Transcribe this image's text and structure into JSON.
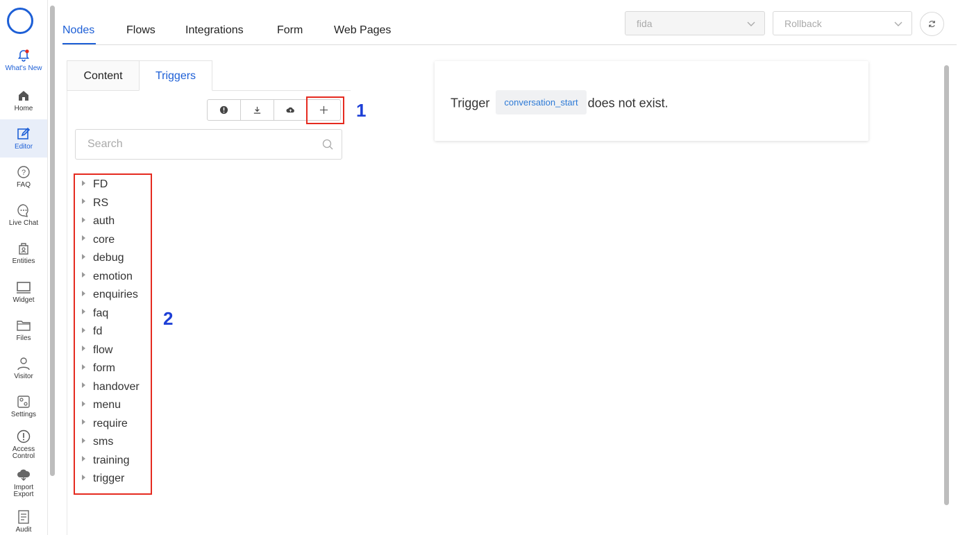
{
  "sidebar": {
    "items": [
      {
        "label": "What's New",
        "icon": "bell-icon"
      },
      {
        "label": "Home",
        "icon": "home-icon"
      },
      {
        "label": "Editor",
        "icon": "edit-icon"
      },
      {
        "label": "FAQ",
        "icon": "question-icon"
      },
      {
        "label": "Live Chat",
        "icon": "chat-icon"
      },
      {
        "label": "Entities",
        "icon": "entities-icon"
      },
      {
        "label": "Widget",
        "icon": "monitor-icon"
      },
      {
        "label": "Files",
        "icon": "folder-icon"
      },
      {
        "label": "Visitor",
        "icon": "user-icon"
      },
      {
        "label": "Settings",
        "icon": "settings-icon"
      },
      {
        "label": "Access Control",
        "icon": "alert-circle-icon"
      },
      {
        "label": "Import Export",
        "icon": "cloud-icon"
      },
      {
        "label": "Audit",
        "icon": "document-icon"
      }
    ],
    "active": "Editor"
  },
  "nav": {
    "tabs": [
      "Nodes",
      "Flows",
      "Integrations",
      "Form",
      "Web Pages"
    ],
    "active": "Nodes",
    "version_select": "fida",
    "rollback_select": "Rollback"
  },
  "panel": {
    "subtabs": [
      "Content",
      "Triggers"
    ],
    "active_subtab": "Triggers",
    "search_placeholder": "Search",
    "toolbar_icons": [
      "info-icon",
      "download-icon",
      "cloud-upload-icon",
      "plus-icon"
    ],
    "tree": [
      "FD",
      "RS",
      "auth",
      "core",
      "debug",
      "emotion",
      "enquiries",
      "faq",
      "fd",
      "flow",
      "form",
      "handover",
      "menu",
      "require",
      "sms",
      "training",
      "trigger"
    ]
  },
  "annotations": {
    "one": "1",
    "two": "2"
  },
  "card": {
    "prefix": "Trigger",
    "tag": "conversation_start",
    "suffix": "does not exist."
  },
  "colors": {
    "accent": "#1d5fd6",
    "highlight": "#e52a1f",
    "annotation": "#1d3fd6"
  }
}
